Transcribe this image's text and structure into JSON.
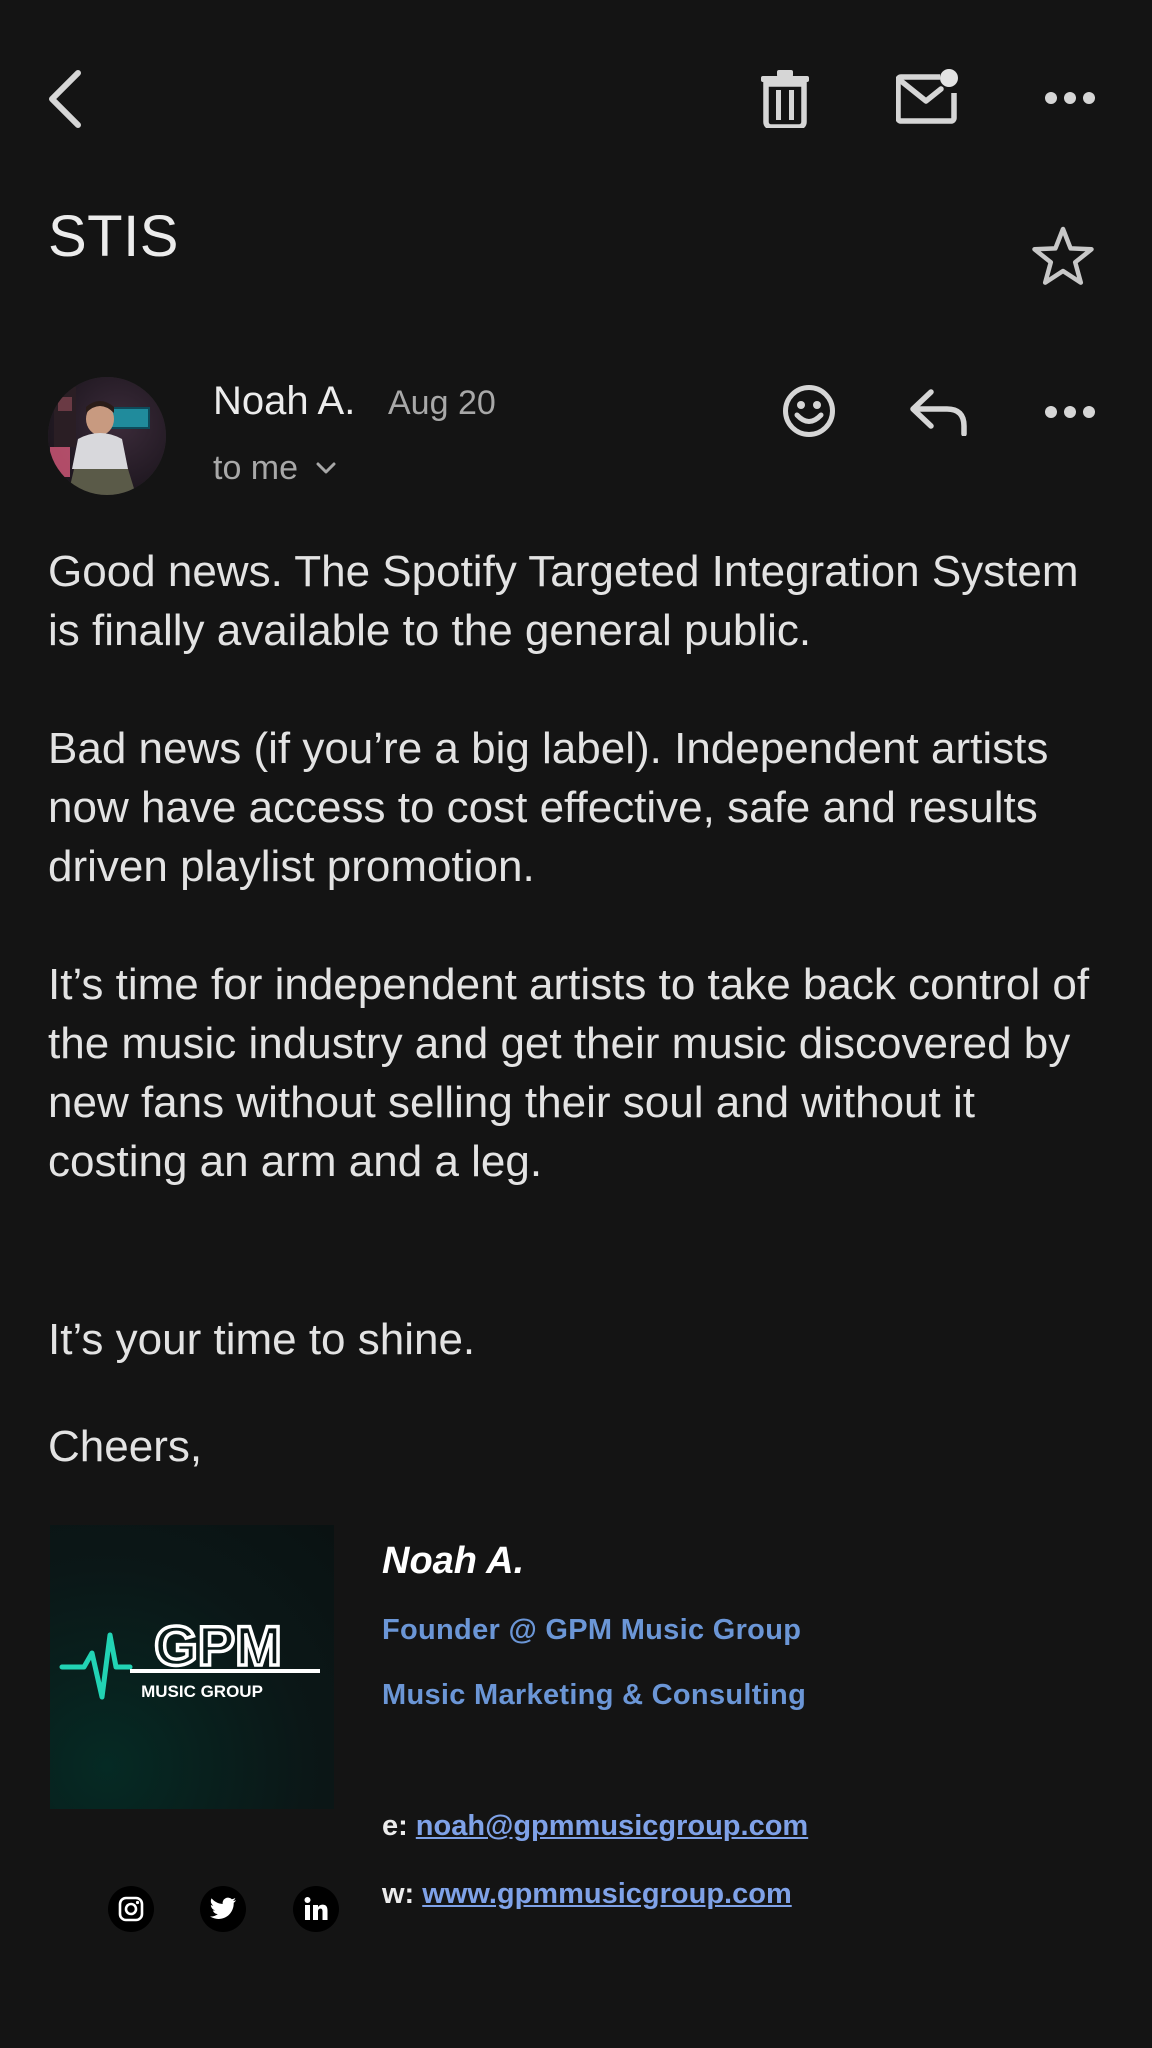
{
  "toolbar": {
    "back_icon": "chevron-left-icon",
    "delete_icon": "trash-icon",
    "mark_unread_icon": "mail-unread-icon",
    "more_icon": "more-horizontal-icon"
  },
  "email": {
    "subject": "STIS",
    "star_icon": "star-outline-icon",
    "sender_name": "Noah A.",
    "date": "Aug 20",
    "recipient": "to me",
    "actions": {
      "emoji_icon": "emoji-reaction-icon",
      "reply_icon": "reply-icon",
      "more_icon": "more-horizontal-icon"
    },
    "paragraphs": [
      "Good news. The Spotify Targeted Integration System is finally available to the general public.",
      "Bad news (if you’re a big label). Independent artists now have access to cost effective, safe and results driven playlist promotion.",
      "It’s time for independent artists to take back control of the music industry and get their music discovered by new fans without selling their soul and without it costing an arm and a leg.",
      "It’s your time to shine.",
      "Cheers,"
    ]
  },
  "signature": {
    "logo_text": "GPM",
    "logo_subtext": "MUSIC GROUP",
    "name": "Noah A.",
    "title": "Founder @ GPM Music Group",
    "tagline": "Music Marketing & Consulting",
    "email_label": "e:",
    "email": "noah@gpmmusicgroup.com",
    "web_label": "w:",
    "website": "www.gpmmusicgroup.com",
    "social_icons": [
      "instagram-icon",
      "twitter-icon",
      "linkedin-icon"
    ]
  },
  "colors": {
    "background": "#141414",
    "text": "#e3e3e3",
    "secondary_text": "#a8a8a8",
    "signature_blue": "#6b96d6",
    "link_blue": "#7fa2e8",
    "logo_teal": "#22d3b4"
  }
}
